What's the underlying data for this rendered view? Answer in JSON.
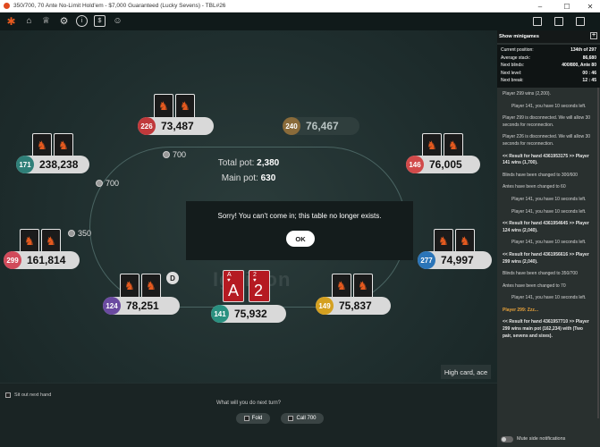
{
  "window": {
    "title": "350/700, 70 Ante No-Limit Hold'em - $7,000 Guaranteed (Lucky Sevens) - TBL#26",
    "controls": [
      "minimize-icon",
      "maximize-icon",
      "close-icon"
    ]
  },
  "toolbar": {
    "left_icons": [
      "home-icon",
      "trophy-icon",
      "gear-icon",
      "info-icon",
      "cashier-icon",
      "emoji-icon"
    ],
    "right_icons": [
      "layout-icon",
      "grid-icon",
      "window-icon"
    ]
  },
  "table": {
    "total_pot_label": "Total pot:",
    "total_pot_value": "2,380",
    "main_pot_label": "Main pot:",
    "main_pot_value": "630",
    "brand_watermark": "Ignition",
    "seats": [
      {
        "num": "226",
        "stack": "73,487",
        "color": "#c0393b"
      },
      {
        "num": "240",
        "stack": "76,467",
        "color": "#8a6b3a"
      },
      {
        "num": "171",
        "stack": "238,238",
        "color": "#2f7f78"
      },
      {
        "num": "146",
        "stack": "76,005",
        "color": "#d14a4a"
      },
      {
        "num": "299",
        "stack": "161,814",
        "color": "#d14a5a"
      },
      {
        "num": "277",
        "stack": "74,997",
        "color": "#2b75b8"
      },
      {
        "num": "124",
        "stack": "78,251",
        "color": "#6a4aa0"
      },
      {
        "num": "141",
        "stack": "75,932",
        "color": "#2a9080"
      },
      {
        "num": "149",
        "stack": "75,837",
        "color": "#d4a020"
      }
    ],
    "bets": [
      "700",
      "700",
      "350"
    ],
    "dealer_button": "D",
    "hero_cards": [
      {
        "rank": "A",
        "suit": "♥"
      },
      {
        "rank": "2",
        "suit": "♥"
      }
    ],
    "hand_name": "High card, ace"
  },
  "modal": {
    "message": "Sorry! You can't come in; this table no longer exists.",
    "ok_label": "OK"
  },
  "actions": {
    "sit_out_label": "Sit out next hand",
    "prompt": "What will you do next turn?",
    "fold_label": "Fold",
    "call_label": "Call 700"
  },
  "sidebar": {
    "header": "Show minigames",
    "stats": [
      {
        "label": "Current position:",
        "value": "134th of 297"
      },
      {
        "label": "Average stack:",
        "value": "86,680"
      },
      {
        "label": "Next blinds:",
        "value": "400/800, Ante 80"
      },
      {
        "label": "Next level:",
        "value": "00 : 46"
      },
      {
        "label": "Next break:",
        "value": "12 : 45"
      }
    ],
    "chat": [
      {
        "text": "Player 299 wins (2,200).",
        "style": "normal"
      },
      {
        "text": "Player 141, you have 10 seconds left.",
        "style": "indent"
      },
      {
        "text": "Player 299 is disconnected. We will allow 30 seconds for reconnection.",
        "style": "normal"
      },
      {
        "text": "Player 226 is disconnected. We will allow 30 seconds for reconnection.",
        "style": "normal"
      },
      {
        "text": "<< Result for hand 4361953175 >> Player 141 wins (1,700).",
        "style": "result"
      },
      {
        "text": "Blinds have been changed to 300/600",
        "style": "normal"
      },
      {
        "text": "Antes have been changed to 60",
        "style": "normal"
      },
      {
        "text": "Player 141, you have 10 seconds left.",
        "style": "indent"
      },
      {
        "text": "Player 141, you have 10 seconds left.",
        "style": "indent"
      },
      {
        "text": "<< Result for hand 4361954645 >> Player 124 wins (2,040).",
        "style": "result"
      },
      {
        "text": "Player 141, you have 10 seconds left.",
        "style": "indent"
      },
      {
        "text": "<< Result for hand 4361956616 >> Player 299 wins (2,040).",
        "style": "result"
      },
      {
        "text": "Blinds have been changed to 350/700",
        "style": "normal"
      },
      {
        "text": "Antes have been changed to 70",
        "style": "normal"
      },
      {
        "text": "Player 141, you have 10 seconds left.",
        "style": "indent"
      },
      {
        "text": "Player 299: Zzz...",
        "style": "orange"
      },
      {
        "text": "<< Result for hand 4361957710 >> Player 299 wins main pot (162,234) with (Two pair, sevens and sixes).",
        "style": "result"
      }
    ],
    "mute_label": "Mute side notifications"
  },
  "colors": {
    "accent_orange": "#e65a1f",
    "felt": "#1f2e2e",
    "hero_card": "#b51a22"
  }
}
